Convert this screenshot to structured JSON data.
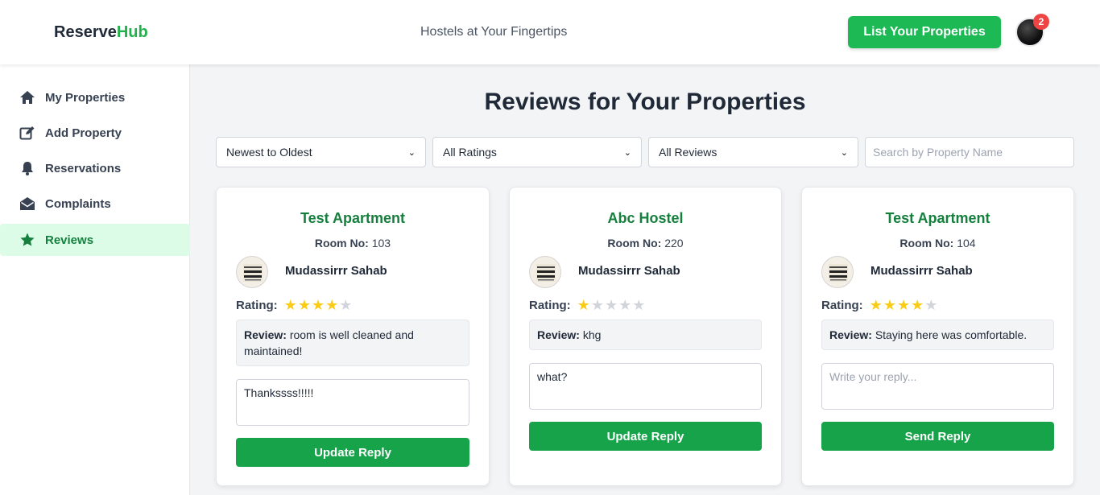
{
  "header": {
    "logo_part1": "Reserve",
    "logo_part2": "Hub",
    "tagline": "Hostels at Your Fingertips",
    "list_button": "List Your Properties",
    "notification_count": "2"
  },
  "sidebar": {
    "items": [
      {
        "label": "My Properties",
        "icon": "home-icon"
      },
      {
        "label": "Add Property",
        "icon": "edit-icon"
      },
      {
        "label": "Reservations",
        "icon": "bell-icon"
      },
      {
        "label": "Complaints",
        "icon": "envelope-open-icon"
      },
      {
        "label": "Reviews",
        "icon": "star-icon",
        "active": true
      }
    ]
  },
  "main": {
    "title": "Reviews for Your Properties",
    "filters": {
      "sort": "Newest to Oldest",
      "ratings": "All Ratings",
      "reviews": "All Reviews",
      "search_placeholder": "Search by Property Name"
    },
    "labels": {
      "room_no": "Room No:",
      "rating": "Rating:",
      "review": "Review:"
    },
    "cards": [
      {
        "property": "Test Apartment",
        "room": "103",
        "user": "Mudassirrr Sahab",
        "rating": 4,
        "review": "room is well cleaned and maintained!",
        "reply_value": "Thankssss!!!!!",
        "reply_placeholder": "Write your reply...",
        "button": "Update Reply"
      },
      {
        "property": "Abc Hostel",
        "room": "220",
        "user": "Mudassirrr Sahab",
        "rating": 1,
        "review": "khg",
        "reply_value": "what?",
        "reply_placeholder": "Write your reply...",
        "button": "Update Reply"
      },
      {
        "property": "Test Apartment",
        "room": "104",
        "user": "Mudassirrr Sahab",
        "rating": 4,
        "review": "Staying here was comfortable.",
        "reply_value": "",
        "reply_placeholder": "Write your reply...",
        "button": "Send Reply"
      }
    ]
  },
  "colors": {
    "brand_green": "#22b14c",
    "button_green": "#16a34a",
    "title_green": "#15803d",
    "star_yellow": "#facc15",
    "badge_red": "#ef4444"
  }
}
